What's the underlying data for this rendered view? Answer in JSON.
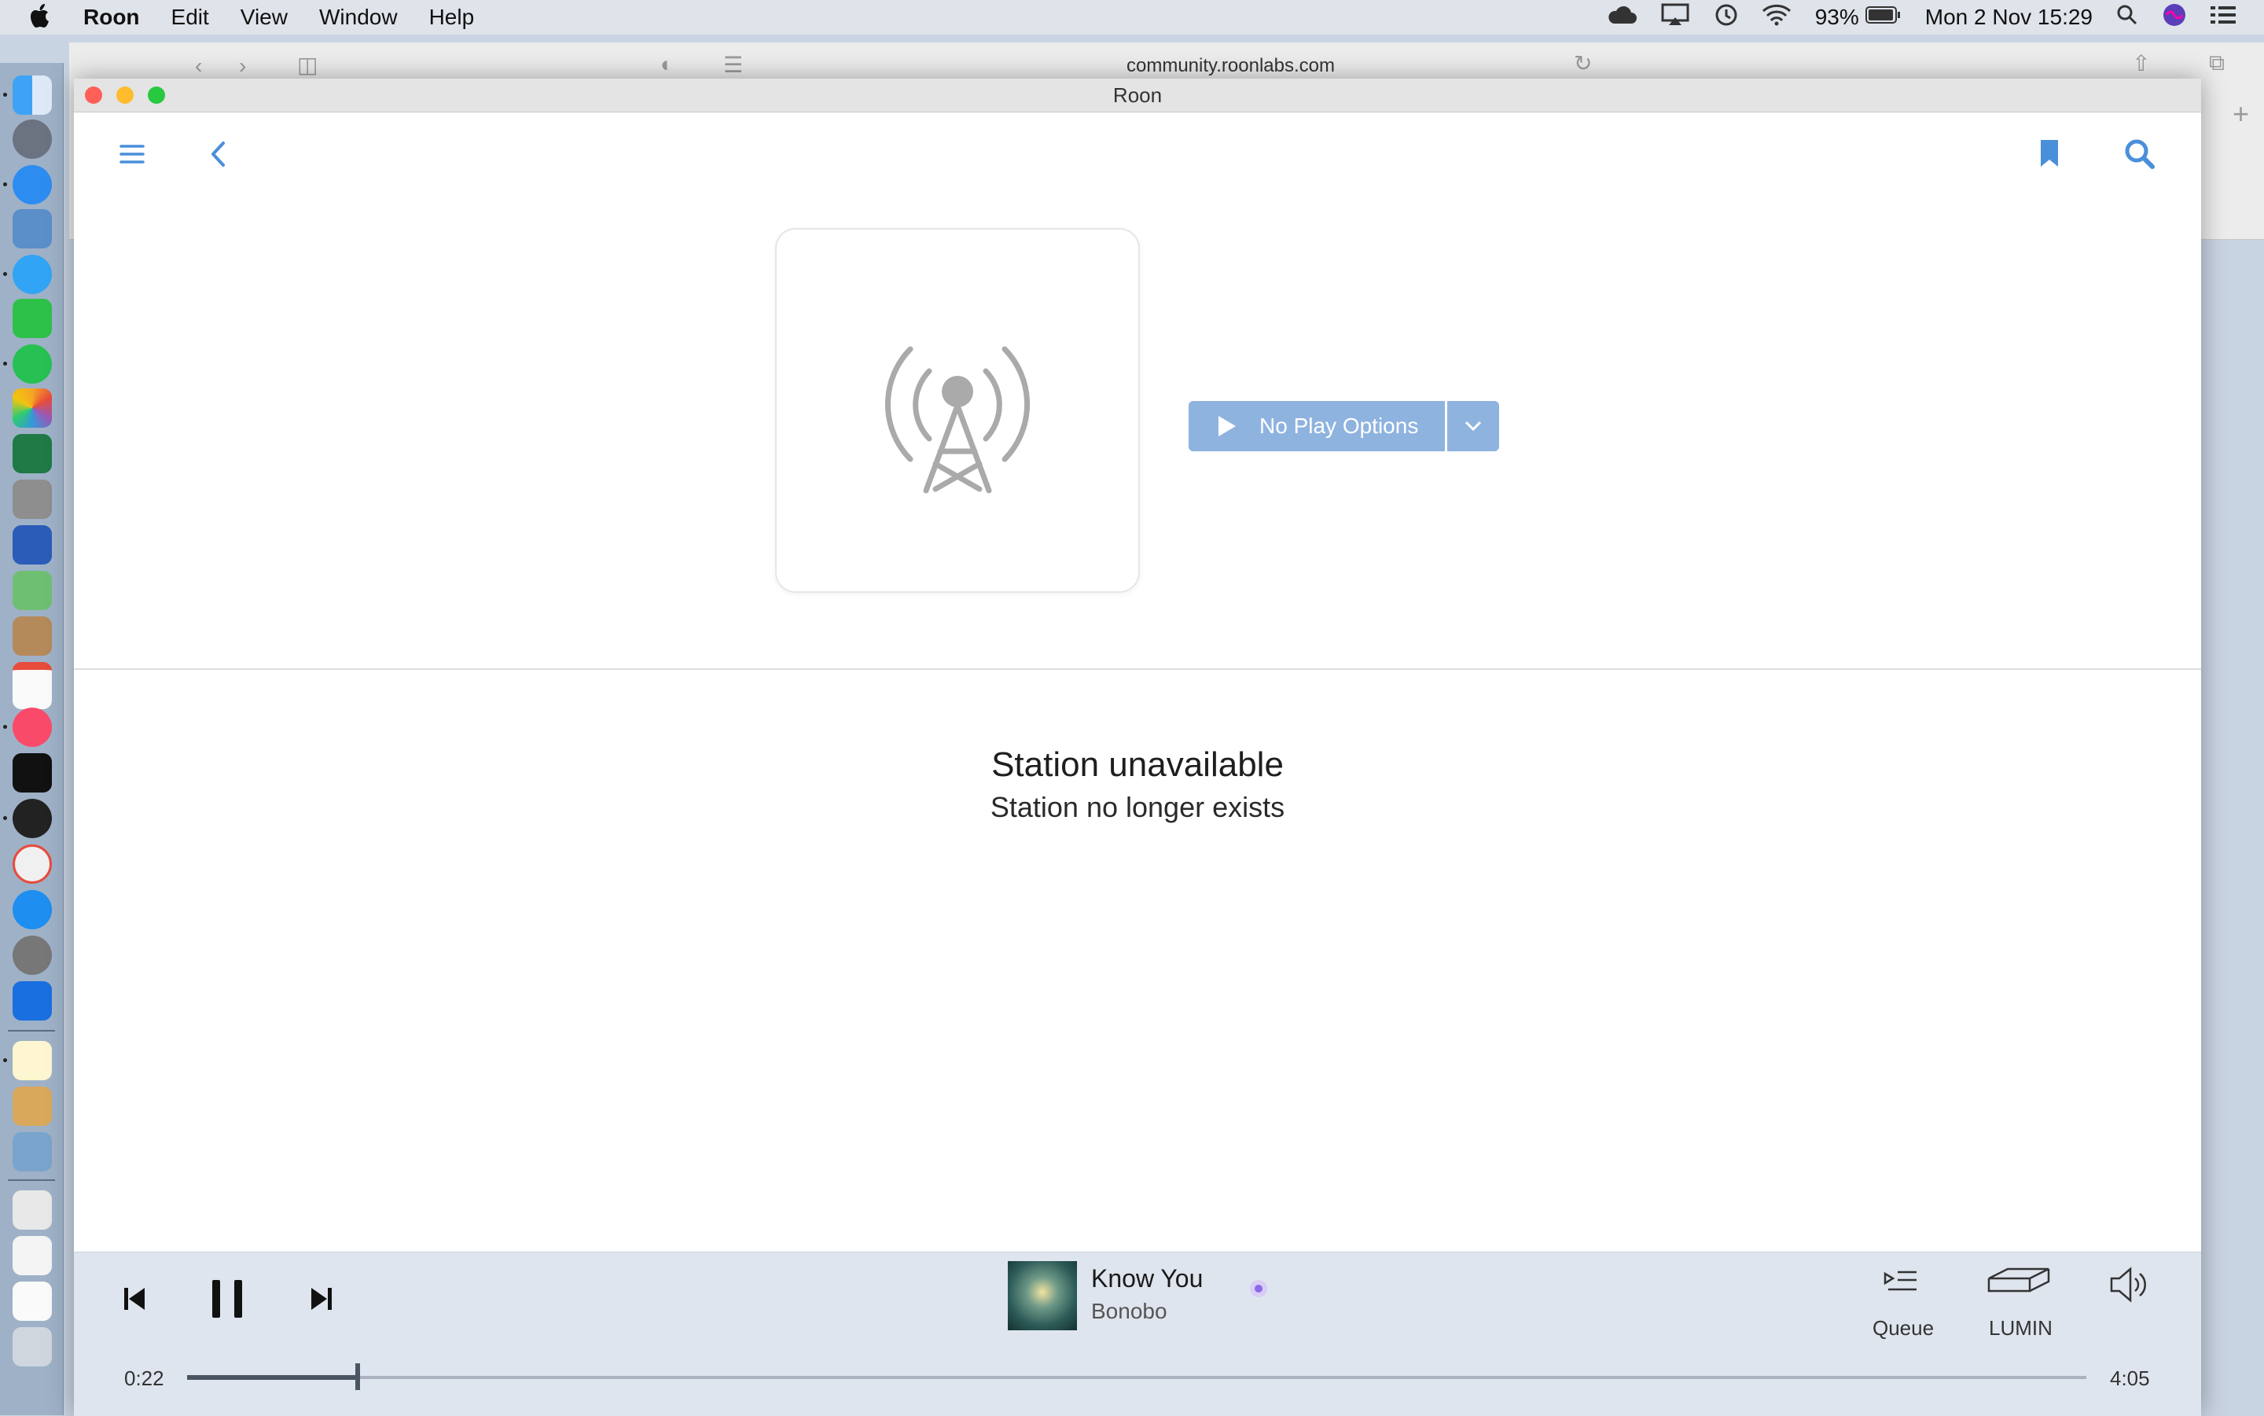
{
  "menubar": {
    "app_name": "Roon",
    "menus": [
      "Edit",
      "View",
      "Window",
      "Help"
    ],
    "battery": "93%",
    "datetime": "Mon 2 Nov  15:29"
  },
  "safari": {
    "url": "community.roonlabs.com"
  },
  "roon": {
    "window_title": "Roon",
    "play_button_label": "No Play Options",
    "status_title": "Station unavailable",
    "status_subtitle": "Station no longer exists",
    "accent_color": "#4a8fd9",
    "play_button_color": "#8fb3df"
  },
  "transport": {
    "elapsed": "0:22",
    "duration": "4:05",
    "progress_fraction": 0.09,
    "track_title": "Know You",
    "track_artist": "Bonobo",
    "queue_label": "Queue",
    "zone_label": "LUMIN"
  }
}
